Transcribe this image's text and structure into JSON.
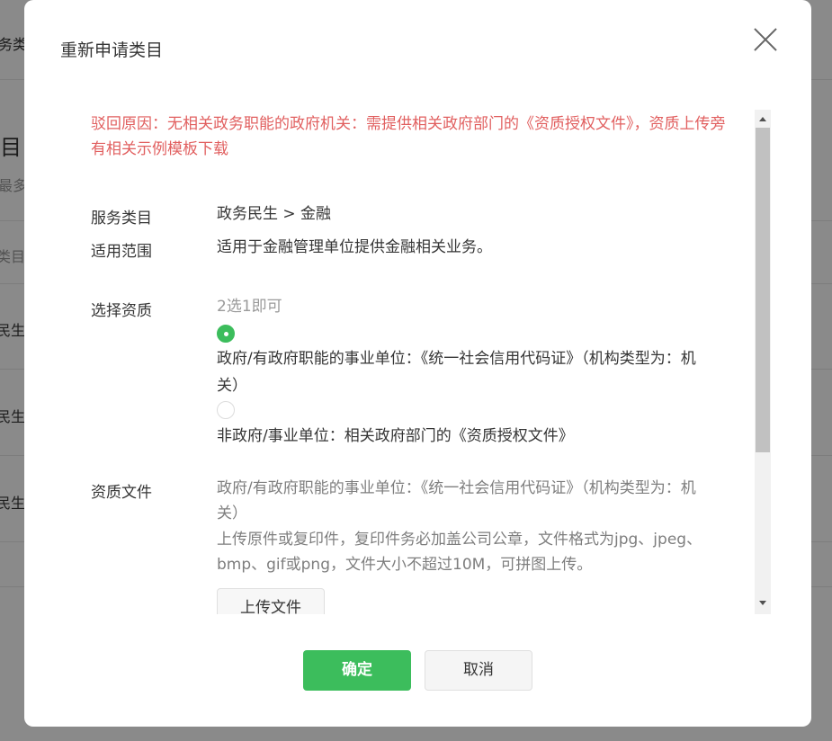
{
  "background": {
    "heading_fragment": "务类",
    "title_fragment": "目",
    "subtitle_fragment": "最多",
    "column_fragment": "类目",
    "rows": [
      "民生",
      "民生",
      "民生"
    ]
  },
  "dialog": {
    "title": "重新申请类目",
    "reject_reason": "驳回原因：无相关政务职能的政府机关：需提供相关政府部门的《资质授权文件》，资质上传旁有相关示例模板下载",
    "service_category": {
      "label": "服务类目",
      "value": "政务民生 > 金融"
    },
    "scope": {
      "label": "适用范围",
      "value": "适用于金融管理单位提供金融相关业务。"
    },
    "qualification": {
      "label": "选择资质",
      "hint": "2选1即可",
      "options": [
        {
          "text": "政府/有政府职能的事业单位：《统一社会信用代码证》（机构类型为：机关）",
          "selected": true
        },
        {
          "text": "非政府/事业单位：相关政府部门的《资质授权文件》",
          "selected": false
        }
      ]
    },
    "documents": {
      "label": "资质文件",
      "description": "政府/有政府职能的事业单位：《统一社会信用代码证》（机构类型为：机关）",
      "requirements": "上传原件或复印件，复印件务必加盖公司公章，文件格式为jpg、jpeg、bmp、gif或png，文件大小不超过10M，可拼图上传。",
      "upload_label": "上传文件"
    },
    "confirm_label": "确定",
    "cancel_label": "取消"
  },
  "colors": {
    "accent": "#3cbd5c",
    "error": "#e15f5f",
    "hint": "#9a9a9a"
  }
}
